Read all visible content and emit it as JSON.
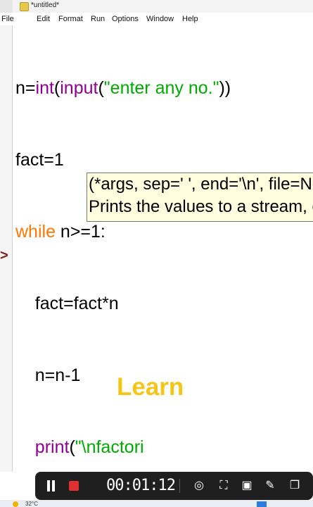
{
  "window": {
    "title": "*untitled*"
  },
  "menu": [
    "File",
    "Edit",
    "Format",
    "Run",
    "Options",
    "Window",
    "Help"
  ],
  "code": {
    "line1": {
      "a": "n=",
      "b": "int",
      "c": "(",
      "d": "input",
      "e": "(",
      "f": "\"enter any no.\"",
      "g": "))"
    },
    "line2": "fact=1",
    "line3": {
      "kw": "while",
      "rest": " n>=1:"
    },
    "line4": "    fact=fact*n",
    "line5": "    n=n-1",
    "line6": {
      "indent": "    ",
      "bi": "print",
      "paren": "(",
      "str": "\"\\nfactori"
    }
  },
  "tooltip": {
    "line1": "(*args, sep=' ', end='\\n', file=None, flush=False)",
    "line2": "Prints the values to a stream, or to sys.stdout by default."
  },
  "shell_prompt": ">",
  "overlay_text": "Learn",
  "recorder": {
    "timer": "00:01:12",
    "icons": [
      "pause-icon",
      "stop-icon",
      "target-icon",
      "crop-icon",
      "camera-icon",
      "pen-icon",
      "window-icon"
    ]
  },
  "taskbar": {
    "temperature": "32°C"
  },
  "colors": {
    "keyword": "#ff7700",
    "builtin": "#900090",
    "string": "#00aa00",
    "overlay": "#f5c518",
    "stop": "#e03030"
  }
}
